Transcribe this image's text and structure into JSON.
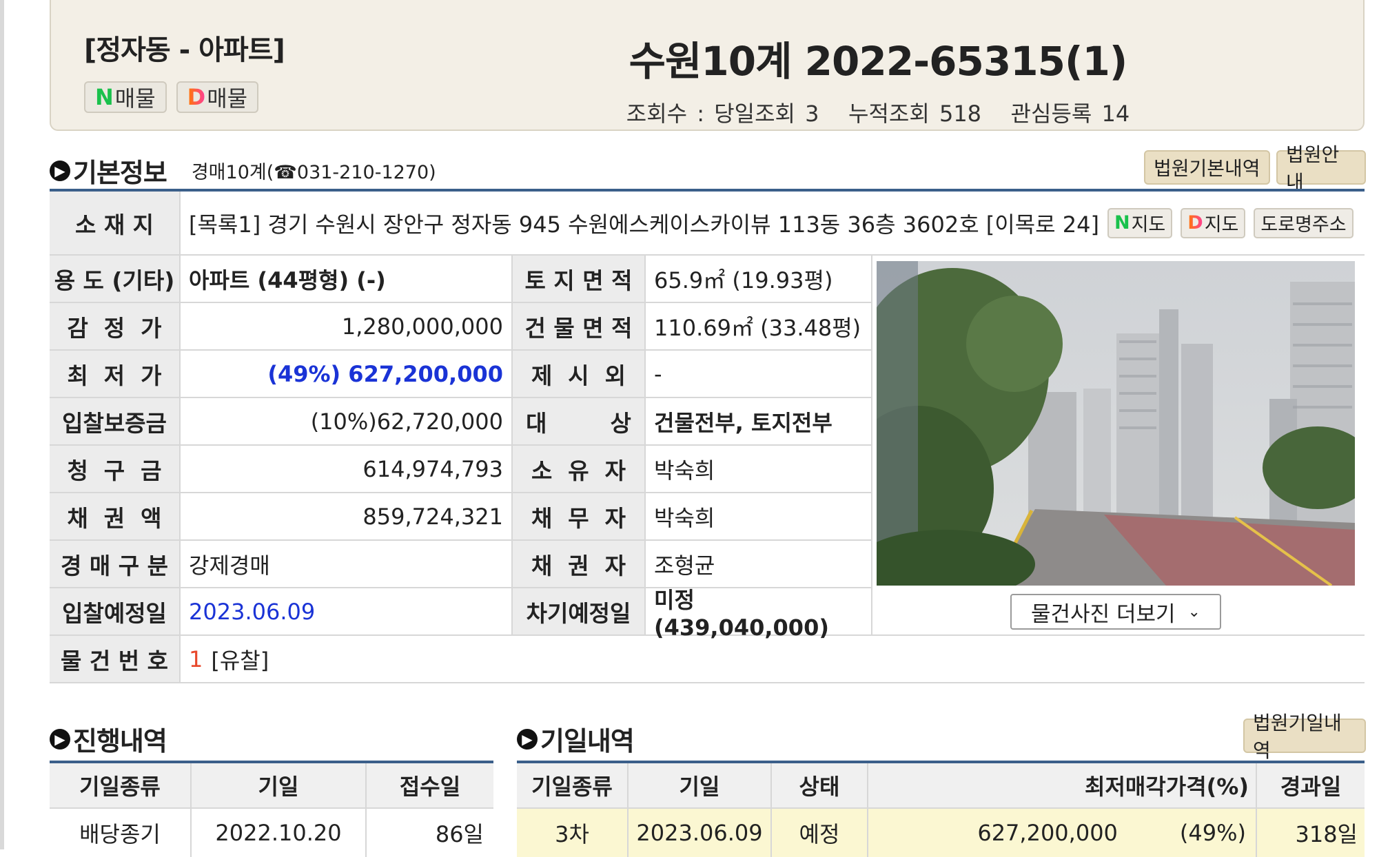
{
  "header": {
    "location": "[정자동 - 아파트]",
    "n_listing": {
      "icon": "N",
      "label": "매물"
    },
    "d_listing": {
      "icon": "D",
      "label": "매물"
    },
    "case_no": "수원10계 2022-65315(1)",
    "views": "조회수 : 당일조회 3   누적조회 518   관심등록 14"
  },
  "basic": {
    "title": "기본정보",
    "court": "경매10계(☎031-210-1270)",
    "btn_court_detail": "법원기본내역",
    "btn_court_guide": "법원안내",
    "address_label": "소 재 지",
    "address": "[목록1] 경기 수원시 장안구 정자동 945 수원에스케이스카이뷰 113동 36층 3602호 [이목로 24]",
    "map_n": {
      "icon": "N",
      "label": "지도"
    },
    "map_d": {
      "icon": "D",
      "label": "지도"
    },
    "road_addr": "도로명주소",
    "rows": [
      {
        "l1": "용 도 (기타)",
        "v1": "아파트 (44평형) (-)",
        "l2": "토 지 면 적",
        "v2": "65.9㎡ (19.93평)"
      },
      {
        "l1": "감  정  가",
        "v1": "1,280,000,000",
        "l2": "건 물 면 적",
        "v2": "110.69㎡ (33.48평)"
      },
      {
        "l1": "최  저  가",
        "v1": "(49%) 627,200,000",
        "l2": "제  시  외",
        "v2": "-"
      },
      {
        "l1": "입찰보증금",
        "v1": "(10%)62,720,000",
        "l2": "대        상",
        "v2": "건물전부, 토지전부"
      },
      {
        "l1": "청  구  금",
        "v1": "614,974,793",
        "l2": "소  유  자",
        "v2": "박숙희"
      },
      {
        "l1": "채  권  액",
        "v1": "859,724,321",
        "l2": "채  무  자",
        "v2": "박숙희"
      },
      {
        "l1": "경 매 구 분",
        "v1": "강제경매",
        "l2": "채  권  자",
        "v2": "조형균"
      },
      {
        "l1": "입찰예정일",
        "v1": "2023.06.09",
        "l2": "차기예정일",
        "v2": "미정 (439,040,000)"
      }
    ],
    "item_no_label": "물 건 번 호",
    "item_no": "1",
    "item_status": "[유찰]",
    "more_photos": "물건사진 더보기"
  },
  "progress": {
    "title": "진행내역",
    "headers": [
      "기일종류",
      "기일",
      "접수일"
    ],
    "rows": [
      {
        "type": "배당종기",
        "date": "2022.10.20",
        "days": "86일"
      }
    ]
  },
  "schedule": {
    "title": "기일내역",
    "btn": "법원기일내역",
    "headers": [
      "기일종류",
      "기일",
      "상태",
      "최저매각가격(%)",
      "경과일"
    ],
    "rows": [
      {
        "type": "3차",
        "date": "2023.06.09",
        "status": "예정",
        "price": "627,200,000",
        "pct": "(49%)",
        "days": "318일"
      }
    ]
  },
  "colors": {
    "accent_line": "#3b5f8a",
    "header_bg": "#f3efe6",
    "highlight_row": "#fbf7d2",
    "link_blue": "#1a33d6",
    "item_no": "#e8472a"
  }
}
